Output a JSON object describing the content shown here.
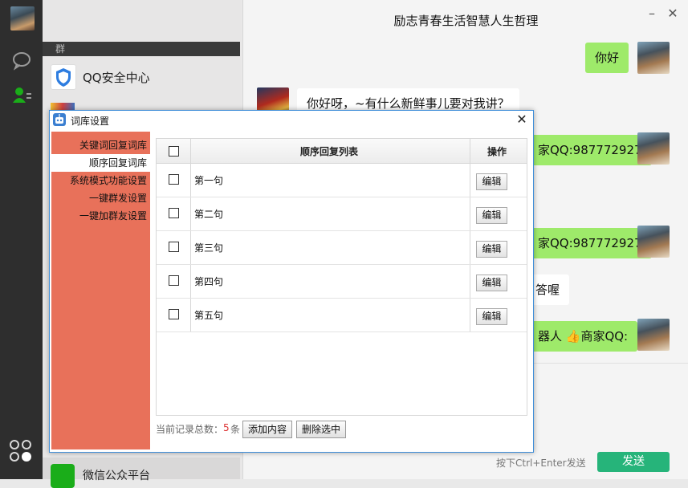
{
  "rail": {
    "icons": [
      "chat-icon",
      "contacts-icon",
      "apps-icon"
    ]
  },
  "contact_list": {
    "group_label": "群",
    "items": [
      {
        "name": "QQ安全中心"
      },
      {
        "name": "微信公众平台"
      }
    ]
  },
  "chat": {
    "title": "励志青春生活智慧人生哲理",
    "messages": [
      {
        "side": "me",
        "text": "你好"
      },
      {
        "side": "bot",
        "text": "你好呀，~有什么新鲜事儿要对我讲？"
      },
      {
        "side": "me",
        "text": "家QQ:987772927"
      },
      {
        "side": "me",
        "text": "家QQ:987772927"
      },
      {
        "side": "bot",
        "text": "答喔"
      },
      {
        "side": "me",
        "text": "器人 👍商家QQ:"
      }
    ],
    "send_hint": "按下Ctrl+Enter发送",
    "send_label": "发送"
  },
  "dialog": {
    "title": "词库设置",
    "menu": [
      {
        "label": "关键词回复词库",
        "active": false
      },
      {
        "label": "顺序回复词库",
        "active": true
      },
      {
        "label": "系统模式功能设置",
        "active": false
      },
      {
        "label": "一键群发设置",
        "active": false
      },
      {
        "label": "一键加群友设置",
        "active": false
      }
    ],
    "table": {
      "col_list": "顺序回复列表",
      "col_action": "操作",
      "rows": [
        {
          "text": "第一句",
          "button": "编辑"
        },
        {
          "text": "第二句",
          "button": "编辑"
        },
        {
          "text": "第三句",
          "button": "编辑"
        },
        {
          "text": "第四句",
          "button": "编辑"
        },
        {
          "text": "第五句",
          "button": "编辑"
        }
      ]
    },
    "footer": {
      "count_label": "当前记录总数：",
      "count_value": "5",
      "count_unit": "条",
      "add_button": "添加内容",
      "delete_button": "删除选中"
    },
    "accent_color": "#e8715a"
  }
}
